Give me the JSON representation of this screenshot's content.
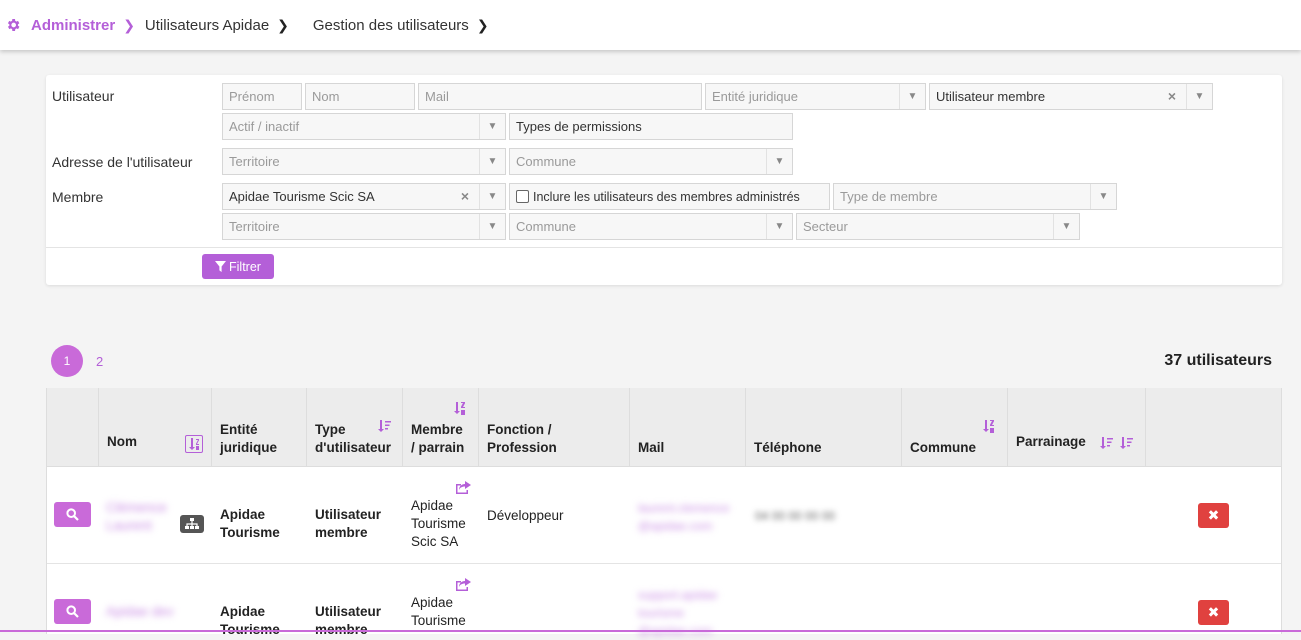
{
  "breadcrumb": {
    "items": [
      "Administrer",
      "Utilisateurs Apidae",
      "Gestion des utilisateurs"
    ]
  },
  "filters": {
    "labels": {
      "utilisateur": "Utilisateur",
      "adresse": "Adresse de l'utilisateur",
      "membre": "Membre"
    },
    "prenom_placeholder": "Prénom",
    "nom_placeholder": "Nom",
    "mail_placeholder": "Mail",
    "entite_placeholder": "Entité juridique",
    "type_utilisateur_value": "Utilisateur membre",
    "actif_placeholder": "Actif / inactif",
    "types_permissions_value": "Types de permissions",
    "territoire_placeholder": "Territoire",
    "commune_placeholder": "Commune",
    "membre_value": "Apidae Tourisme Scic SA",
    "inclure_label": "Inclure les utilisateurs des membres administrés",
    "type_membre_placeholder": "Type de membre",
    "territoire2_placeholder": "Territoire",
    "commune2_placeholder": "Commune",
    "secteur_placeholder": "Secteur",
    "filter_button": "Filtrer"
  },
  "pagination": {
    "pages": [
      "1",
      "2"
    ],
    "current": "1"
  },
  "count_label": "37 utilisateurs",
  "table": {
    "headers": {
      "nom": "Nom",
      "entite_1": "Entité",
      "entite_2": "juridique",
      "type_1": "Type",
      "type_2": "d'utilisateur",
      "membre_1": "Membre",
      "membre_2": "/ parrain",
      "fonction_1": "Fonction /",
      "fonction_2": "Profession",
      "mail": "Mail",
      "telephone": "Téléphone",
      "commune": "Commune",
      "parrainage": "Parrainage"
    },
    "rows": [
      {
        "nom_1": "Clémence",
        "nom_2": "Laurent",
        "entite_1": "Apidae",
        "entite_2": "Tourisme",
        "type_1": "Utilisateur",
        "type_2": "membre",
        "membre_1": "Apidae",
        "membre_2": "Tourisme",
        "membre_3": "Scic SA",
        "fonction": "Développeur",
        "mail_1": "laurent.clemence",
        "mail_2": "@apidae.com",
        "telephone": "04 00 00 00 00"
      },
      {
        "nom_1": "Apidae dev",
        "entite_1": "Apidae",
        "entite_2": "Tourisme",
        "type_1": "Utilisateur",
        "type_2": "membre",
        "membre_1": "Apidae",
        "membre_2": "Tourisme",
        "mail_1": "support.apidae",
        "mail_2": "tourisme",
        "mail_3": "@apidae.com"
      }
    ]
  },
  "colors": {
    "accent": "#b45fd8",
    "danger": "#e0413f"
  }
}
